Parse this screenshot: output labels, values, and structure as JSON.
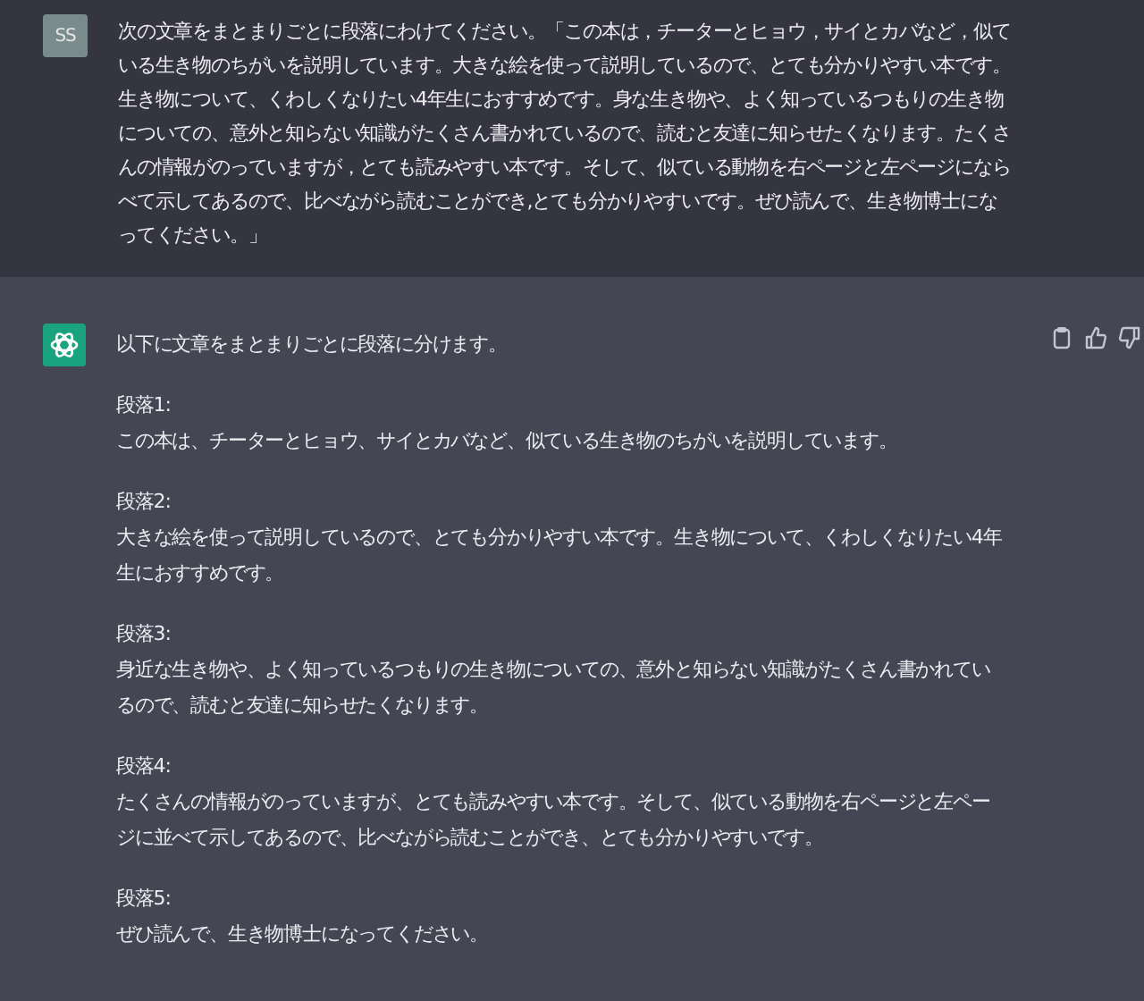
{
  "user_message": {
    "avatar": "SS",
    "text": "次の文章をまとまりごとに段落にわけてください。「この本は，チーターとヒョウ，サイとカバなど，似ている生き物のちがいを説明しています。大きな絵を使って説明しているので、とても分かりやすい本です。生き物について、くわしくなりたい4年生におすすめです。身な生き物や、よく知っているつもりの生き物についての、意外と知らない知識がたくさん書かれているので、読むと友達に知らせたくなります。たくさんの情報がのっていますが，とても読みやすい本です。そして、似ている動物を右ページと左ページにならべて示してあるので、比べながら読むことができ,とても分かりやすいです。ぜひ読んで、生き物博士になってください。」"
  },
  "assistant_message": {
    "intro": "以下に文章をまとまりごとに段落に分けます。",
    "paragraphs": [
      {
        "heading": "段落1:",
        "body": "この本は、チーターとヒョウ、サイとカバなど、似ている生き物のちがいを説明しています。"
      },
      {
        "heading": "段落2:",
        "body": "大きな絵を使って説明しているので、とても分かりやすい本です。生き物について、くわしくなりたい4年生におすすめです。"
      },
      {
        "heading": "段落3:",
        "body": "身近な生き物や、よく知っているつもりの生き物についての、意外と知らない知識がたくさん書かれているので、読むと友達に知らせたくなります。"
      },
      {
        "heading": "段落4:",
        "body": "たくさんの情報がのっていますが、とても読みやすい本です。そして、似ている動物を右ページと左ページに並べて示してあるので、比べながら読むことができ、とても分かりやすいです。"
      },
      {
        "heading": "段落5:",
        "body": "ぜひ読んで、生き物博士になってください。"
      }
    ]
  }
}
